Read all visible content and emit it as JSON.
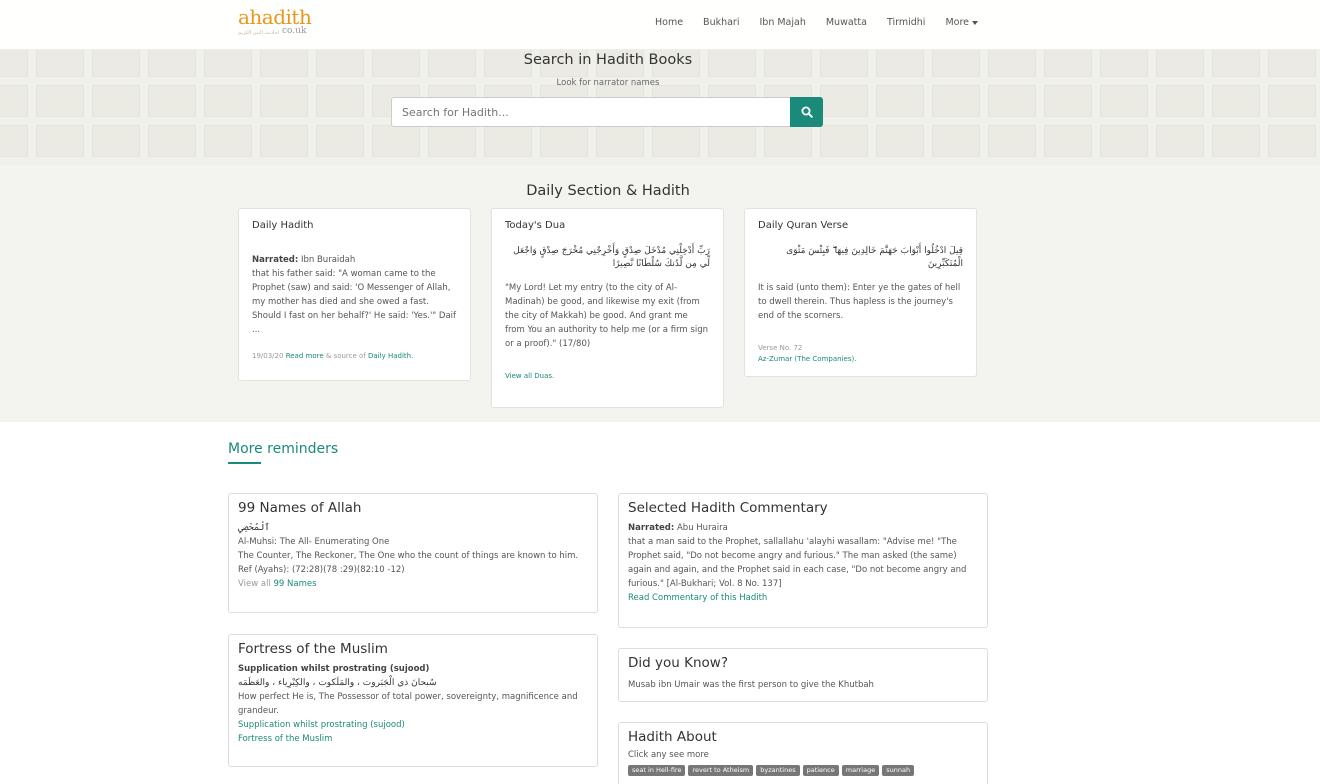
{
  "logo": {
    "main": "ahadith",
    "sub": "co.uk",
    "arabic": "أحاديث النبي الكريم"
  },
  "nav": {
    "items": [
      "Home",
      "Bukhari",
      "Ibn Majah",
      "Muwatta",
      "Tirmidhi"
    ],
    "more": "More"
  },
  "search": {
    "title": "Search in Hadith Books",
    "subtitle": "Look for narrator names",
    "placeholder": "Search for Hadith..."
  },
  "daily": {
    "title": "Daily Section & Hadith",
    "hadith": {
      "title": "Daily Hadith",
      "narrated_label": "Narrated:",
      "narrator": "Ibn Buraidah",
      "text": "that his father said: \"A woman came to the Prophet (saw) and said: 'O Messenger of Allah, my mother has died and she owed a fast. Should I fast on her behalf?' He said: 'Yes.'\" Daif ...",
      "date": "19/03/20",
      "read_more": "Read more",
      "source_text": "& source of",
      "source_link": "Daily Hadith."
    },
    "dua": {
      "title": "Today's Dua",
      "arabic": "رَبِّ أَدْخِلْنِي مُدْخَلَ صِدْقٍ وَأَخْرِجْنِي مُخْرَجَ صِدْقٍ وَاجْعَل لِّي مِن لَّدُنكَ سُلْطَانًا نَّصِيرًا",
      "text": "\"My Lord! Let my entry (to the city of Al-Madinah) be good, and likewise my exit (from the city of Makkah) be good. And grant me from You an authority to help me (or a firm sign or a proof).\" (17/80)",
      "link": "View all Duas."
    },
    "quran": {
      "title": "Daily Quran Verse",
      "arabic": "قِيلَ ادْخُلُوا أَبْوَابَ جَهَنَّمَ خَالِدِينَ فِيهَا ۖ فَبِئْسَ مَثْوَى الْمُتَكَبِّرِينَ",
      "text": "It is said (unto them): Enter ye the gates of hell to dwell therein. Thus hapless is the journey's end of the scorners.",
      "verse": "Verse No. 72",
      "surah": "Az-Zumar (The Companies)."
    }
  },
  "reminders": {
    "title": "More reminders",
    "names": {
      "title": "99 Names of Allah",
      "arabic": "ٱلْمُحْصِي",
      "name": "Al-Muhsi: The All- Enumerating One",
      "desc": "The Counter, The Reckoner, The One who the count of things are known to him.",
      "ref": "Ref (Ayahs): (72:28)(78 :29)(82:10 -12)",
      "view_all": "View all",
      "link": "99 Names"
    },
    "commentary": {
      "title": "Selected Hadith Commentary",
      "narrated_label": "Narrated:",
      "narrator": "Abu Huraira",
      "text": "that a man said to the Prophet, sallallahu 'alayhi wasallam: \"Advise me! \"The Prophet said, \"Do not become angry and furious.\" The man asked (the same) again and again, and the Prophet said in each case, \"Do not become angry and furious.\" [Al-Bukhari; Vol. 8 No. 137]",
      "link": "Read Commentary of this Hadith"
    },
    "fortress": {
      "title": "Fortress of the Muslim",
      "subtitle": "Supplication whilst prostrating (sujood)",
      "arabic": "سُبحانَ ذي الْجَبَروت ، والمَلَكوت ، والكِبْرِياء ، والعَظَمَه",
      "text": "How perfect He is, The Possessor of total power, sovereignty, magnificence and grandeur.",
      "link1": "Supplication whilst prostrating (sujood)",
      "link2": "Fortress of the Muslim"
    },
    "didyouknow": {
      "title": "Did you Know?",
      "text": "Musab ibn Umair was the first person to give the Khutbah"
    },
    "about": {
      "title": "Hadith About",
      "text": "Click any see more",
      "tags": [
        "seat in Hell-fire",
        "revert to Atheism",
        "byzantines",
        "patience",
        "marriage",
        "sunnah"
      ]
    }
  },
  "colors": {
    "accent": "#1a8a7a",
    "logo": "#e8971c"
  }
}
